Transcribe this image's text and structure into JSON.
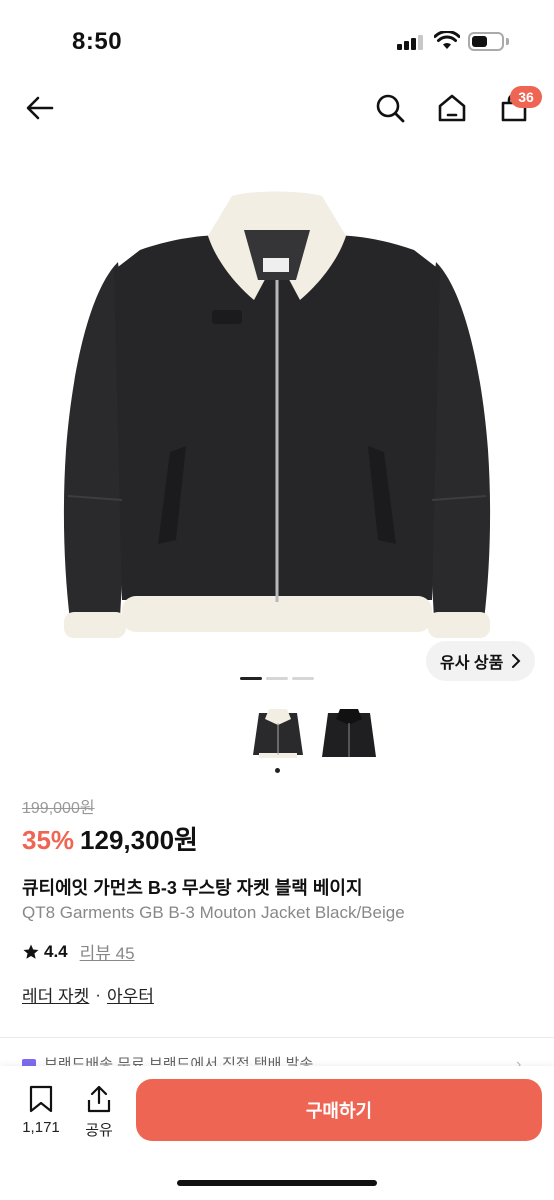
{
  "status_bar": {
    "time": "8:50",
    "battery_level": 0.55,
    "signal_bars_active": 3
  },
  "nav": {
    "back_icon": "arrow-left-icon",
    "search_icon": "search-icon",
    "home_icon": "home-icon",
    "cart_icon": "shopping-bag-icon",
    "cart_badge": "36"
  },
  "gallery": {
    "similar_label": "유사 상품",
    "current_page": 1,
    "page_count": 3
  },
  "product": {
    "original_price": "199,000원",
    "discount": "35%",
    "price": "129,300원",
    "title_ko": "큐티에잇 가먼츠 B-3 무스탕 자켓 블랙 베이지",
    "title_en": "QT8 Garments GB B-3 Mouton Jacket Black/Beige",
    "rating": "4.4",
    "review_label": "리뷰 45",
    "category": "레더 자켓",
    "category_sep": "·",
    "subcategory": "아우터"
  },
  "shipping": {
    "text": "브랜드배송 무료  브랜드에서 직접 택배 발송"
  },
  "bottom_bar": {
    "wishlist_count": "1,171",
    "share_label": "공유",
    "buy_label": "구매하기"
  },
  "colors": {
    "accent": "#ef6553",
    "text": "#111111",
    "muted": "#888888"
  }
}
